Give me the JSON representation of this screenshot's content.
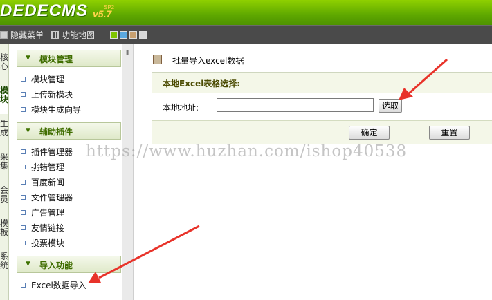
{
  "header": {
    "logo": "DEDECMS",
    "version": "v5.7",
    "version_tag": "SP2"
  },
  "menubar": {
    "items": [
      {
        "label": "隐藏菜单",
        "icon": "hide-menu-icon"
      },
      {
        "label": "功能地图",
        "icon": "grid-map-icon"
      }
    ],
    "skins": [
      "#7fc400",
      "#5aa8e0",
      "#c8a070",
      "#d8d8d8"
    ]
  },
  "left_tabs": [
    {
      "label": "核心"
    },
    {
      "label": "模块",
      "active": true
    },
    {
      "label": "生成"
    },
    {
      "label": "采集"
    },
    {
      "label": "会员"
    },
    {
      "label": "模板"
    },
    {
      "label": "系统"
    }
  ],
  "sidebar": {
    "sections": [
      {
        "title": "模块管理",
        "items": [
          "模块管理",
          "上传新模块",
          "模块生成向导"
        ]
      },
      {
        "title": "辅助插件",
        "items": [
          "插件管理器",
          "挑错管理",
          "百度新闻",
          "文件管理器",
          "广告管理",
          "友情链接",
          "投票模块"
        ]
      },
      {
        "title": "导入功能",
        "items": [
          "Excel数据导入"
        ]
      }
    ]
  },
  "content": {
    "page_title": "批量导入excel数据",
    "panel_title": "本地Excel表格选择:",
    "field_label": "本地地址:",
    "field_value": "",
    "browse_label": "选取",
    "confirm_label": "确定",
    "reset_label": "重置"
  },
  "watermark": "https://www.huzhan.com/ishop40538",
  "colors": {
    "brand_green": "#5ea800",
    "annotation_red": "#e8332a"
  }
}
